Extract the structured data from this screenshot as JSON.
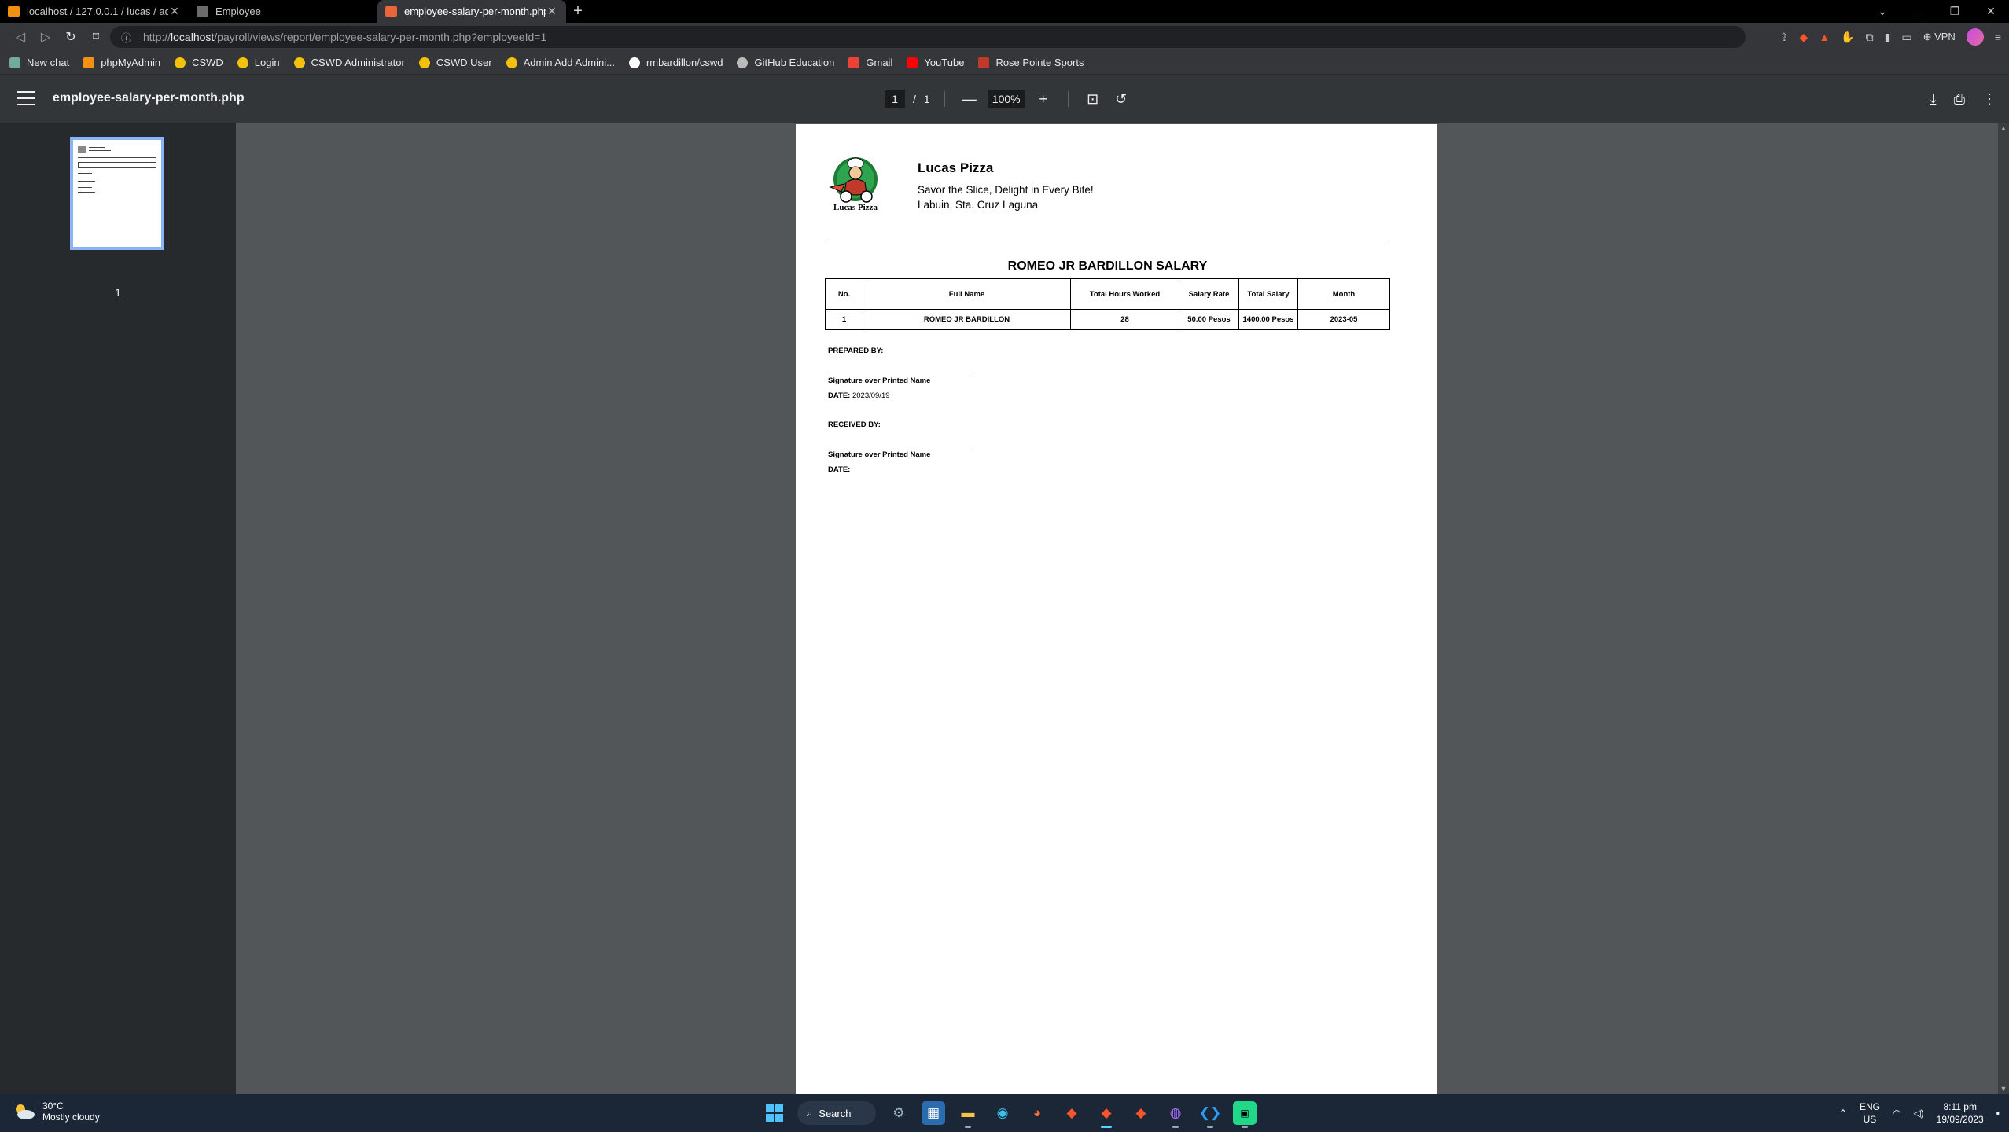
{
  "browser": {
    "tabs": [
      {
        "title": "localhost / 127.0.0.1 / lucas / adm",
        "favicon_color": "#f29111",
        "active": false
      },
      {
        "title": "Employee",
        "favicon_color": "#6b6b6b",
        "active": false
      },
      {
        "title": "employee-salary-per-month.php",
        "favicon_color": "#e8663a",
        "active": true
      }
    ],
    "new_tab_symbol": "+",
    "url_prefix": "http://",
    "url_host": "localhost",
    "url_path": "/payroll/views/report/employee-salary-per-month.php?employeeId=1",
    "vpn_label": "VPN",
    "bookmarks": [
      {
        "label": "New chat",
        "color": "#74aa9c"
      },
      {
        "label": "phpMyAdmin",
        "color": "#f29111"
      },
      {
        "label": "CSWD",
        "color": "#f4c20d"
      },
      {
        "label": "Login",
        "color": "#f4c20d"
      },
      {
        "label": "CSWD Administrator",
        "color": "#f4c20d"
      },
      {
        "label": "CSWD User",
        "color": "#f4c20d"
      },
      {
        "label": "Admin Add Admini...",
        "color": "#f4c20d"
      },
      {
        "label": "rmbardillon/cswd",
        "color": "#ffffff"
      },
      {
        "label": "GitHub Education",
        "color": "#ffffff"
      },
      {
        "label": "Gmail",
        "color": "#ea4335"
      },
      {
        "label": "YouTube",
        "color": "#ff0000"
      },
      {
        "label": "Rose Pointe Sports",
        "color": "#c0392b"
      }
    ]
  },
  "pdf_viewer": {
    "file_title": "employee-salary-per-month.php",
    "current_page": "1",
    "page_separator": "/",
    "total_pages": "1",
    "zoom": "100%",
    "thumbnail_label": "1"
  },
  "document": {
    "company_name": "Lucas Pizza",
    "tagline": "Savor the Slice, Delight in Every Bite!",
    "address": "Labuin, Sta. Cruz Laguna",
    "logo_text": "Lucas Pizza",
    "title": "ROMEO JR BARDILLON SALARY",
    "table": {
      "headers": [
        "No.",
        "Full Name",
        "Total Hours Worked",
        "Salary Rate",
        "Total Salary",
        "Month"
      ],
      "rows": [
        [
          "1",
          "ROMEO JR BARDILLON",
          "28",
          "50.00 Pesos",
          "1400.00 Pesos",
          "2023-05"
        ]
      ]
    },
    "prepared_by_label": "PREPARED BY:",
    "signature_label_1": "Signature over Printed Name",
    "date_label_1": "DATE:",
    "date_value_1": "2023/09/19",
    "received_by_label": "RECEIVED BY:",
    "signature_label_2": "Signature over Printed Name",
    "date_label_2": "DATE:"
  },
  "taskbar": {
    "temperature": "30°C",
    "weather": "Mostly cloudy",
    "search_label": "Search",
    "lang_top": "ENG",
    "lang_bottom": "US",
    "time": "8:11 pm",
    "date": "19/09/2023"
  }
}
